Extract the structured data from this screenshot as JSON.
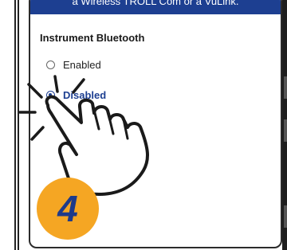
{
  "banner": {
    "text": "a Wireless TROLL Com or a VuLink."
  },
  "section": {
    "title": "Instrument Bluetooth"
  },
  "options": [
    {
      "label": "Enabled",
      "selected": false
    },
    {
      "label": "Disabled",
      "selected": true
    }
  ],
  "step": {
    "number": "4"
  },
  "colors": {
    "accent": "#1d3f91",
    "badge": "#f5a623",
    "badge_text": "#1e3a8a"
  },
  "icons": {
    "tap_hand": "tap-hand-icon"
  }
}
